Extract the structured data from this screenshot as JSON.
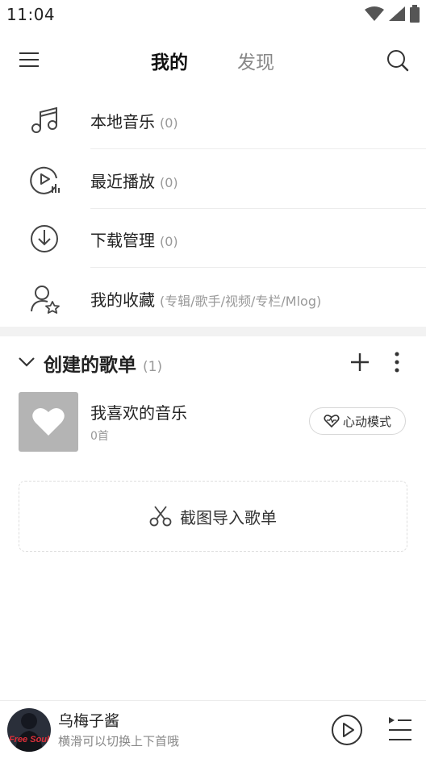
{
  "status_bar": {
    "time": "11:04",
    "icons": [
      "wifi-icon",
      "signal-icon",
      "battery-icon"
    ]
  },
  "top_nav": {
    "tabs": [
      {
        "label": "我的",
        "active": true
      },
      {
        "label": "发现",
        "active": false
      }
    ],
    "left_icon": "menu-icon",
    "right_icon": "search-icon"
  },
  "library": {
    "items": [
      {
        "label": "本地音乐",
        "count": "(0)",
        "icon": "music-note-icon"
      },
      {
        "label": "最近播放",
        "count": "(0)",
        "icon": "recent-play-icon"
      },
      {
        "label": "下载管理",
        "count": "(0)",
        "icon": "download-icon"
      },
      {
        "label": "我的收藏",
        "count": "(专辑/歌手/视频/专栏/Mlog)",
        "icon": "favorite-user-icon"
      }
    ]
  },
  "playlists": {
    "title": "创建的歌单",
    "count": "(1)",
    "items": [
      {
        "title": "我喜欢的音乐",
        "subtitle": "0首",
        "action_label": "心动模式"
      }
    ],
    "import_label": "截图导入歌单"
  },
  "mini_player": {
    "title": "乌梅子酱",
    "subtitle": "横滑可以切换上下首哦",
    "album_text": "Free Soul"
  },
  "colors": {
    "accent": "#e0303a",
    "muted": "#999999",
    "divider": "#ececec"
  }
}
